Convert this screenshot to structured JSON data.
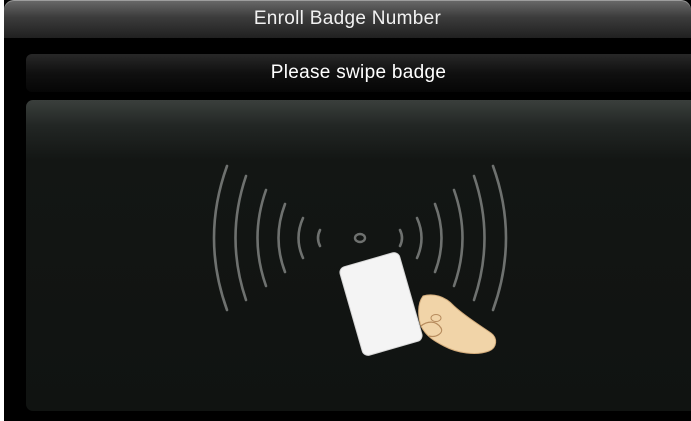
{
  "header": {
    "title": "Enroll Badge Number"
  },
  "prompt": {
    "text": "Please swipe badge"
  },
  "illustration": {
    "icon": "badge-swipe-icon",
    "wave_color": "#6e716f",
    "card_color": "#f4f4f4",
    "hand_color": "#f1d4a8"
  }
}
